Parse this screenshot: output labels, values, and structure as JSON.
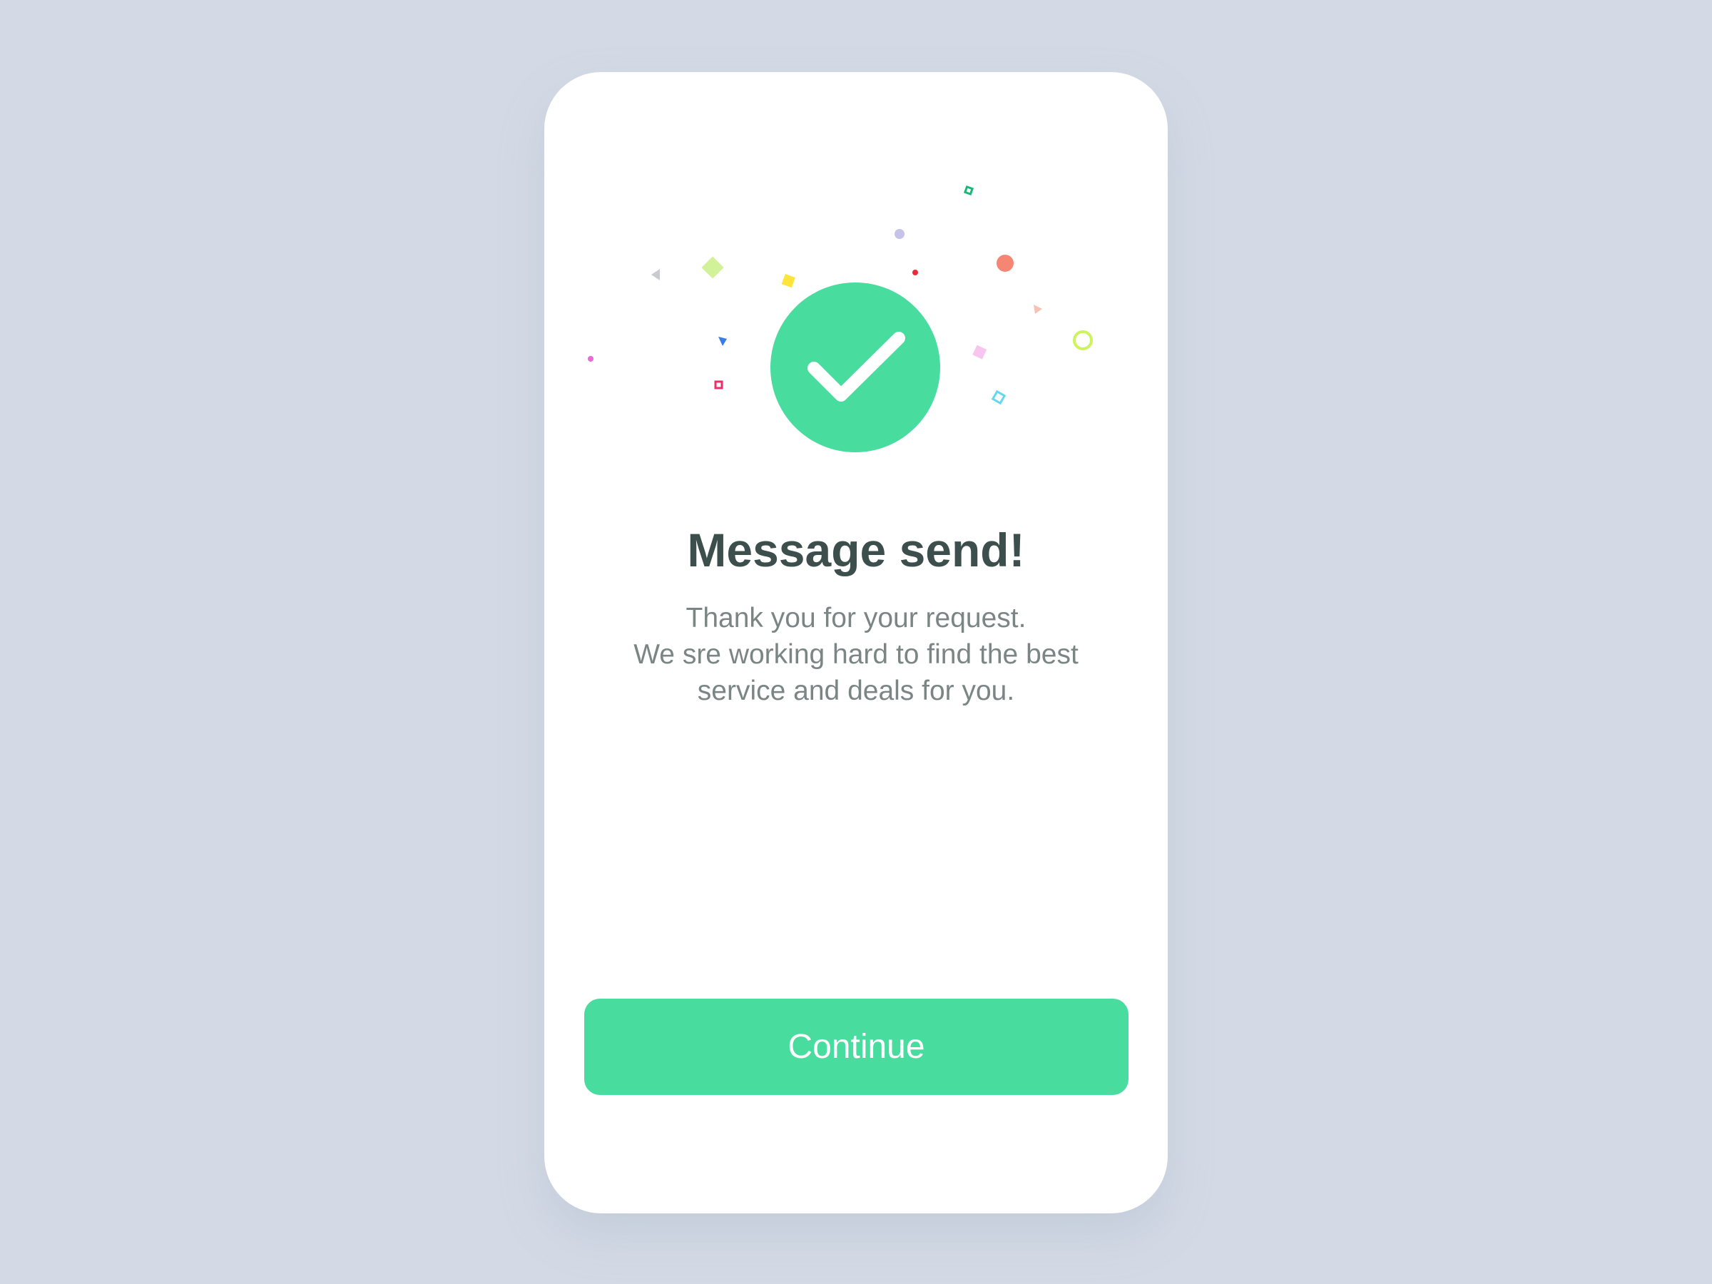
{
  "dialog": {
    "title": "Message send!",
    "message_lines": [
      "Thank you for your request.",
      "We sre working hard to find the best",
      "service and deals for you."
    ],
    "continue_label": "Continue"
  },
  "icons": {
    "status": "check-circle-icon",
    "decoration": "confetti-icon"
  },
  "colors": {
    "page_background": "#d3dae5",
    "card_background": "#ffffff",
    "accent": "#48dc9e",
    "title_text": "#3d4f4c",
    "body_text": "#7b8684",
    "button_text": "#ffffff"
  }
}
